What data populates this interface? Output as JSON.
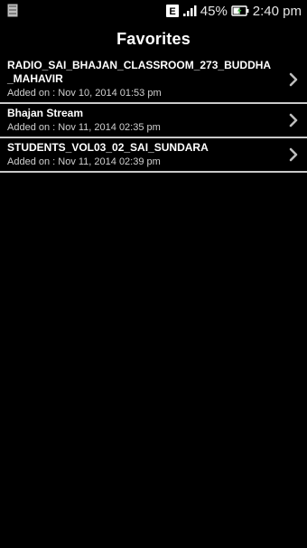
{
  "status_bar": {
    "battery_percent": "45%",
    "time": "2:40 pm",
    "notification_badge": "E",
    "icons": [
      "notification-icon",
      "lte-badge-icon",
      "signal-icon",
      "battery-charging-icon"
    ]
  },
  "header": {
    "title": "Favorites"
  },
  "favorites": [
    {
      "title": "RADIO_SAI_BHAJAN_CLASSROOM_273_BUDDHA_MAHAVIR",
      "added": "Added on : Nov 10, 2014 01:53 pm"
    },
    {
      "title": "Bhajan Stream",
      "added": "Added on : Nov 11, 2014 02:35 pm"
    },
    {
      "title": "STUDENTS_VOL03_02_SAI_SUNDARA",
      "added": "Added on : Nov 11, 2014 02:39 pm"
    }
  ],
  "colors": {
    "background": "#000000",
    "text": "#ffffff",
    "subtext": "#d0d0d0",
    "divider": "#c9c9c9",
    "chevron": "#bdbdbd"
  }
}
